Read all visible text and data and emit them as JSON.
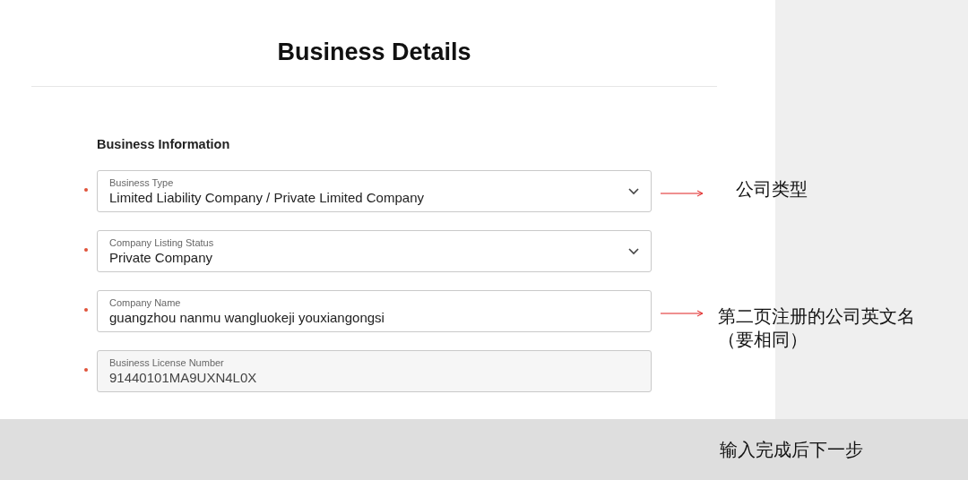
{
  "title": "Business Details",
  "section": "Business Information",
  "fields": [
    {
      "kind": "select",
      "label": "Business Type",
      "value": "Limited Liability Company / Private Limited Company",
      "required": true,
      "disabled": false,
      "note_lines": [
        "公司类型"
      ]
    },
    {
      "kind": "select",
      "label": "Company Listing Status",
      "value": "Private Company",
      "required": true,
      "disabled": false
    },
    {
      "kind": "text",
      "label": "Company Name",
      "value": "guangzhou nanmu wangluokeji youxiangongsi",
      "required": true,
      "disabled": false,
      "note_lines": [
        "第二页注册的公司英文名",
        "（要相同）"
      ]
    },
    {
      "kind": "text",
      "label": "Business License Number",
      "value": "91440101MA9UXN4L0X",
      "required": true,
      "disabled": true
    }
  ],
  "footer_note": "输入完成后下一步"
}
